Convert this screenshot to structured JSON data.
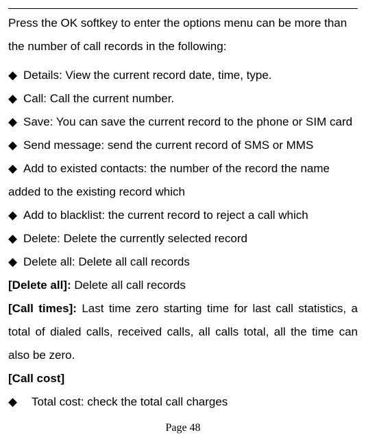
{
  "intro": "Press the OK softkey to enter the options menu can be more than the number of call records in the following:",
  "bullet": "◆",
  "items": [
    "Details: View the current record date, time, type.",
    "Call: Call the current number.",
    "Save: You can save the current record to the phone or SIM card",
    "Send message: send the current record of SMS or MMS",
    "Add to existed contacts: the number of the record the name added to the existing record which",
    "Add to blacklist: the current record to reject a call which",
    "Delete: Delete the currently selected record",
    "Delete all: Delete all call records"
  ],
  "sections": {
    "delete_all_label": "[Delete all]: ",
    "delete_all_text": "Delete all call records",
    "call_times_label": "[Call times]: ",
    "call_times_text": "Last time zero starting time for last call statistics, a total of dialed calls, received calls, all calls total, all the time can also be zero.",
    "call_cost_label": "[Call cost]"
  },
  "cost_item": "Total cost: check the total call charges",
  "page_label": "Page 48"
}
